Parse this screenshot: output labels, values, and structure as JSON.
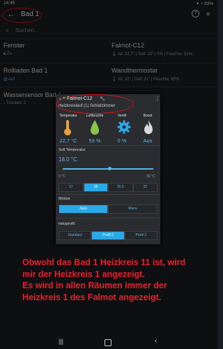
{
  "status": {
    "time": "14:45",
    "battery": "93%"
  },
  "header": {
    "title": "Bad 1",
    "back_icon": "arrow-left-icon",
    "help_icon": "help-icon",
    "filter_icon": "filter-icon"
  },
  "search": {
    "placeholder": "Suchen..."
  },
  "cards": [
    {
      "title": "Fenster",
      "sub": "Zu"
    },
    {
      "title": "Falmot-C12",
      "sub": "Ist: 22,7° | Soll: 18° | 0% | Feuchte: 53%"
    },
    {
      "title": "Rollladen Bad 1",
      "sub": "Auf"
    },
    {
      "title": "Wandthermostat",
      "sub": "Ist: 22° | Soll: 21° | Feuchte: 65%"
    },
    {
      "title": "Wassersensor Bad 1",
      "sub": "Trocken: 2"
    }
  ],
  "dialog": {
    "title": "Falmot-C12",
    "subtitle": "Heizkreislauf (1) Schlafzimmer",
    "columns": [
      {
        "label": "Temperatur",
        "value": "22,7 °C",
        "icon": "thermometer-icon"
      },
      {
        "label": "Luftfeuchte",
        "value": "53 %",
        "icon": "droplet-icon"
      },
      {
        "label": "Ventil",
        "value": "0 %",
        "icon": "gear-icon"
      },
      {
        "label": "Boost",
        "value": "Aus",
        "icon": "flame-icon"
      }
    ],
    "soll_label": "Soll Temperatur",
    "soll_value": "18,0 °C",
    "slider_min": "5 °C",
    "slider_max": "30 °C",
    "slider_level": 0.52,
    "temps": [
      "17",
      "18",
      "20.5",
      "22"
    ],
    "temps_selected": 1,
    "modus_label": "Modus",
    "modus": [
      "Auto",
      "Manu"
    ],
    "modus_selected": 0,
    "heizprofil_label": "Heizprofil",
    "profiles": [
      "Standard",
      "Profil 2",
      "Profil 3"
    ],
    "profile_selected": 1
  },
  "note": {
    "line1": "Obwohl das Bad 1 Heizkreis 11 ist, wird",
    "line2": "mir der Heizkreis 1 angezeigt.",
    "line3": "Es wird in allen Räumen immer der",
    "line4": "Heizkreis 1 des Falmot angezeigt."
  },
  "colors": {
    "accent": "#2aa8e8",
    "annotation": "#e01515"
  }
}
